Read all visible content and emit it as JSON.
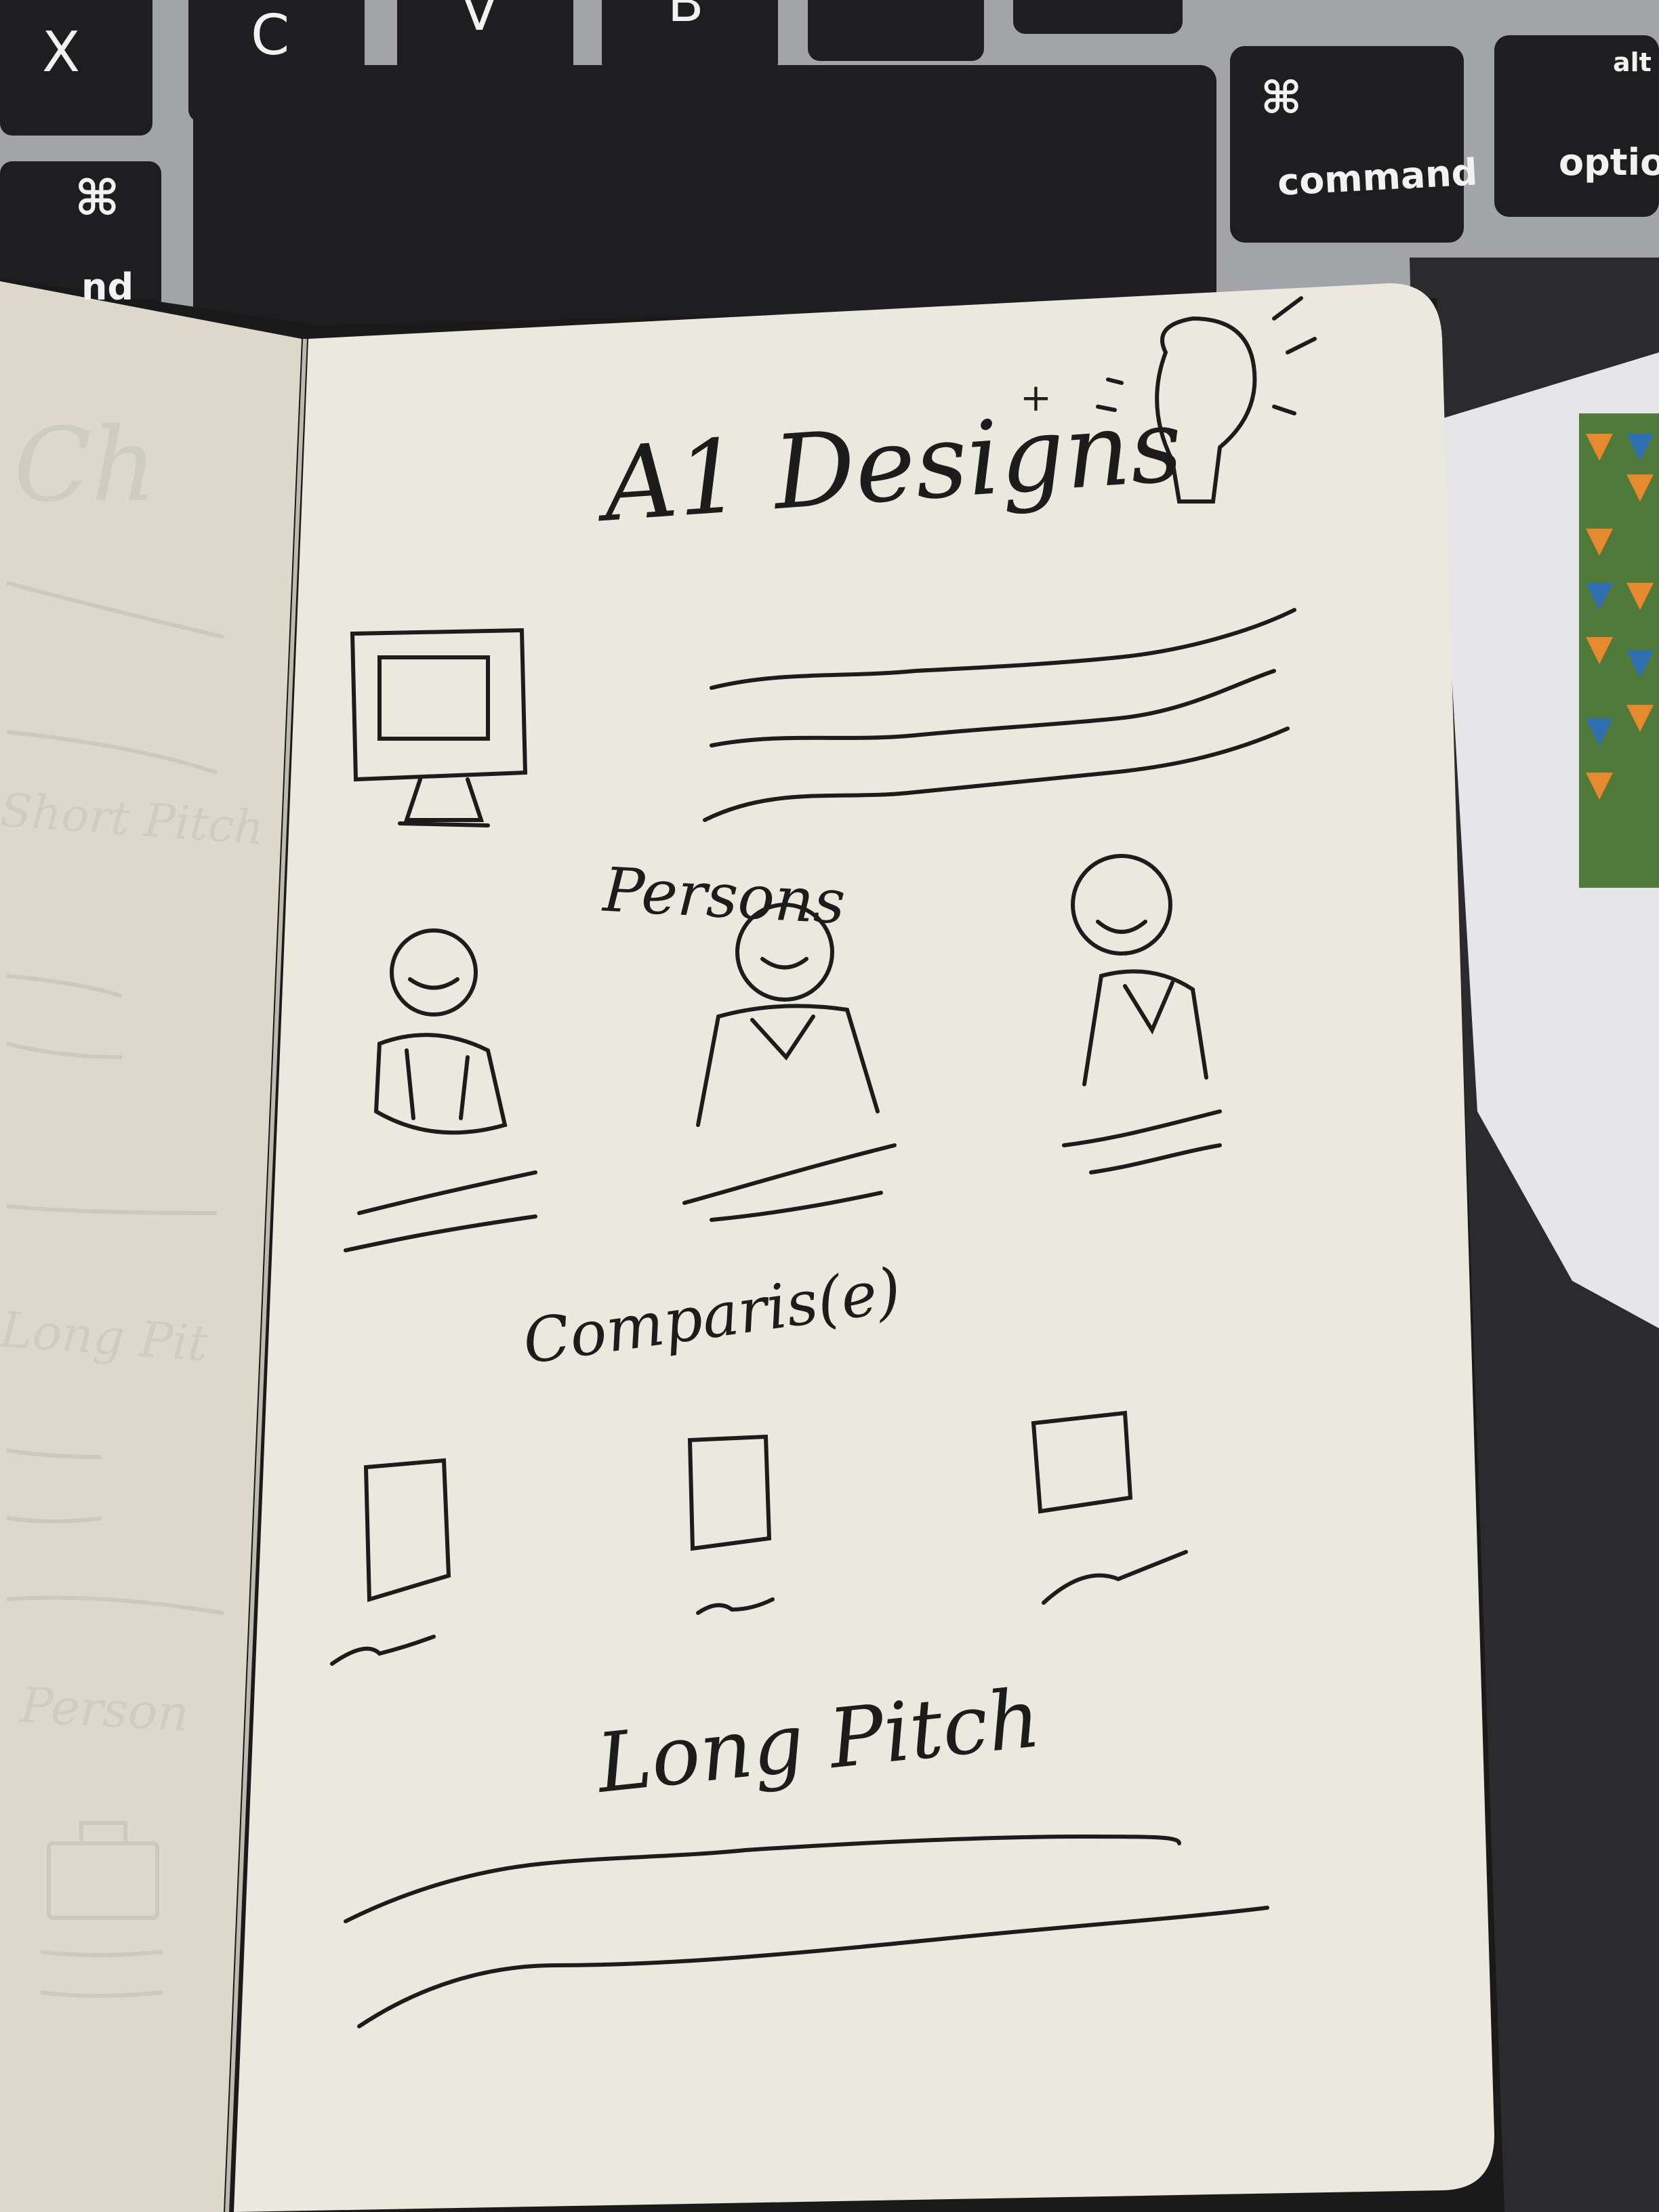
{
  "keyboard": {
    "keys": {
      "x": "X",
      "c": "C",
      "v": "V",
      "b": "B",
      "command_left_symbol": "⌘",
      "command_left_partial": "nd",
      "command_right_symbol": "⌘",
      "command_right_label": "command",
      "alt_label": "alt",
      "option_label": "optior"
    }
  },
  "notebook": {
    "right_page": {
      "title": "A1 Designs",
      "title_mark": "+",
      "sections": {
        "personas": "Persons",
        "comparisons": "Comparis(e)",
        "long_pitch": "Long Pitch"
      }
    },
    "left_page_showthrough": {
      "top": "Ch",
      "short_pitch": "Short Pitch",
      "long_pitch": "Long Pit",
      "personas": "Person"
    }
  },
  "colors": {
    "paper": "#ebe8dd",
    "ink": "#1c1c1c",
    "key": "#1e1e20",
    "laptop_body": "#9fa0a3"
  }
}
